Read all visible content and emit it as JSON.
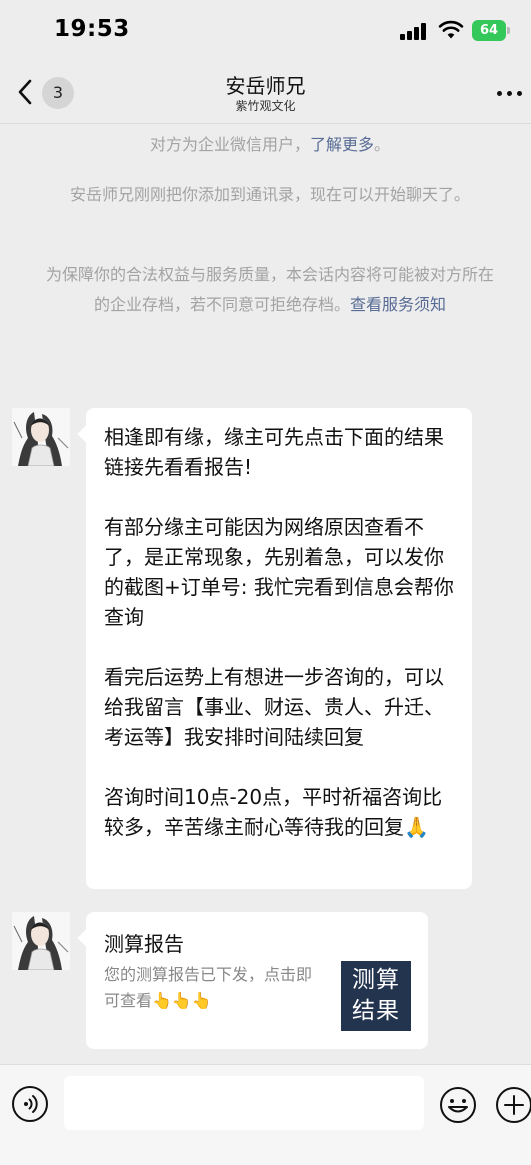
{
  "status_bar": {
    "time": "19:53",
    "battery": "64",
    "battery_color": "#34c759",
    "icons": [
      "cellular-signal-icon",
      "wifi-icon",
      "battery-icon"
    ]
  },
  "nav": {
    "back_icon": "chevron-left-icon",
    "unread_count": "3",
    "title": "安岳师兄",
    "subtitle": "紫竹观文化",
    "more_icon": "more-icon"
  },
  "system_notices": {
    "enterprise_prefix": "对方为企业微信用户，",
    "enterprise_link": "了解更多",
    "enterprise_suffix": "。",
    "added_contact": "安岳师兄刚刚把你添加到通讯录，现在可以开始聊天了。",
    "archive_text": "为保障你的合法权益与服务质量，本会话内容将可能被对方所在的企业存档，若不同意可拒绝存档。",
    "archive_link": "查看服务须知",
    "link_color": "#576b95"
  },
  "messages": [
    {
      "paragraphs": [
        "相逢即有缘，缘主可先点击下面的结果链接先看看报告!",
        "有部分缘主可能因为网络原因查看不了，是正常现象，先别着急，可以发你的截图+订单号: 我忙完看到信息会帮你查询",
        "看完后运势上有想进一步咨询的，可以给我留言【事业、财运、贵人、升迁、考运等】我安排时间陆续回复",
        "咨询时间10点-20点，平时祈福咨询比较多，辛苦缘主耐心等待我的回复🙏"
      ]
    },
    {
      "card_title": "测算报告",
      "card_description": "您的测算报告已下发，点击即可查看👆👆👆",
      "card_thumbnail": "测算结果",
      "thumbnail_color": "#23344f"
    }
  ],
  "input_bar": {
    "placeholder": "",
    "icons": [
      "voice-icon",
      "emoji-icon",
      "plus-icon"
    ]
  }
}
